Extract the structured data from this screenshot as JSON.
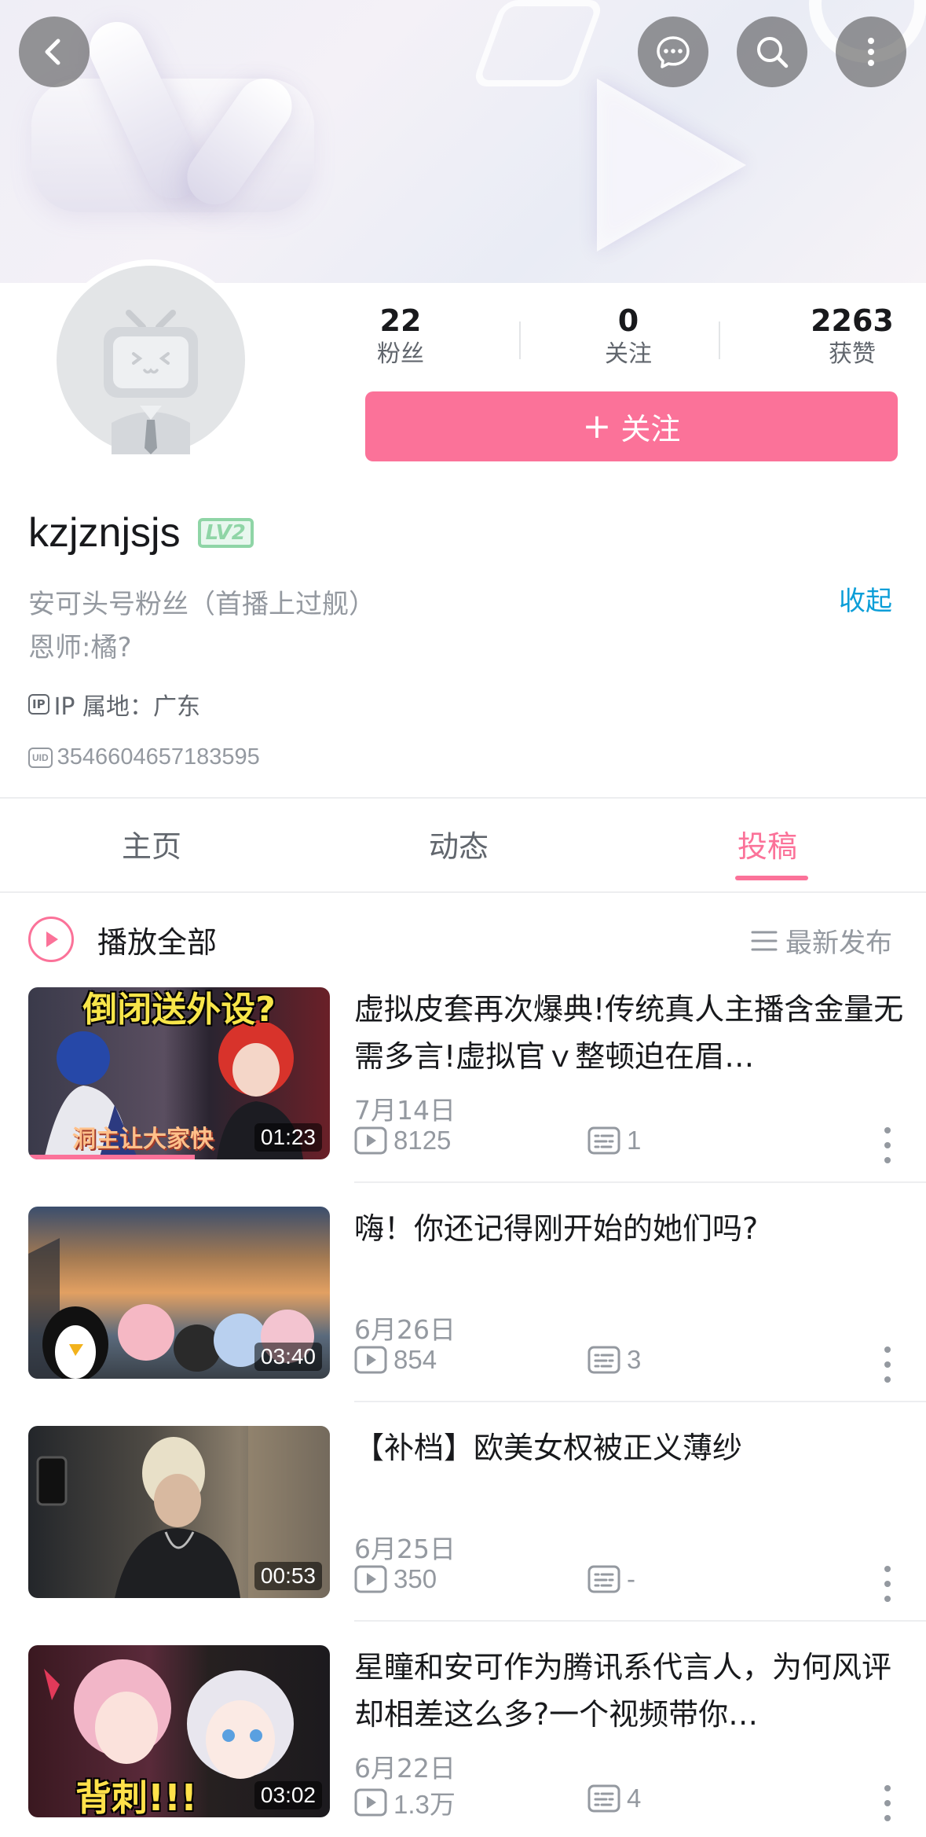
{
  "colors": {
    "accent": "#fb7299",
    "link": "#0b9ed8",
    "level_badge": "#8fd5a6"
  },
  "icons": {
    "back": "chevron-left-icon",
    "message": "chat-bubble-icon",
    "search": "search-icon",
    "more": "vertical-dots-icon"
  },
  "profile": {
    "stats": {
      "fans": {
        "value": "22",
        "label": "粉丝"
      },
      "following": {
        "value": "0",
        "label": "关注"
      },
      "likes": {
        "value": "2263",
        "label": "获赞"
      }
    },
    "follow_button": {
      "plus": "+",
      "label": "关注"
    },
    "username": "kzjznjsjs",
    "level": "LV2",
    "sign_line1": "安可头号粉丝（首播上过舰）",
    "sign_line2": "恩师:橘?",
    "collapse_label": "收起",
    "ip_badge": "IP",
    "ip_text": "IP 属地：广东",
    "uid_badge": "UID",
    "uid": "3546604657183595"
  },
  "tabs": [
    {
      "label": "主页",
      "active": false
    },
    {
      "label": "动态",
      "active": false
    },
    {
      "label": "投稿",
      "active": true
    }
  ],
  "list_header": {
    "play_all": "播放全部",
    "sort": "最新发布"
  },
  "videos": [
    {
      "title": "虚拟皮套再次爆典!传统真人主播含金量无需多言!虚拟官ｖ整顿迫在眉…",
      "date": "7月14日",
      "views": "8125",
      "danmaku": "1",
      "duration": "01:23",
      "watched": 0.55,
      "thumb_text": "倒闭送外设?",
      "thumb_caption": "洞主让大家快"
    },
    {
      "title": "嗨！你还记得刚开始的她们吗?",
      "date": "6月26日",
      "views": "854",
      "danmaku": "3",
      "duration": "03:40",
      "watched": 0
    },
    {
      "title": "【补档】欧美女权被正义薄纱",
      "date": "6月25日",
      "views": "350",
      "danmaku": "-",
      "duration": "00:53",
      "watched": 0
    },
    {
      "title": "星瞳和安可作为腾讯系代言人，为何风评却相差这么多?一个视频带你…",
      "date": "6月22日",
      "views": "1.3万",
      "danmaku": "4",
      "duration": "03:02",
      "watched": 0,
      "thumb_caption": "背刺!!!"
    }
  ]
}
